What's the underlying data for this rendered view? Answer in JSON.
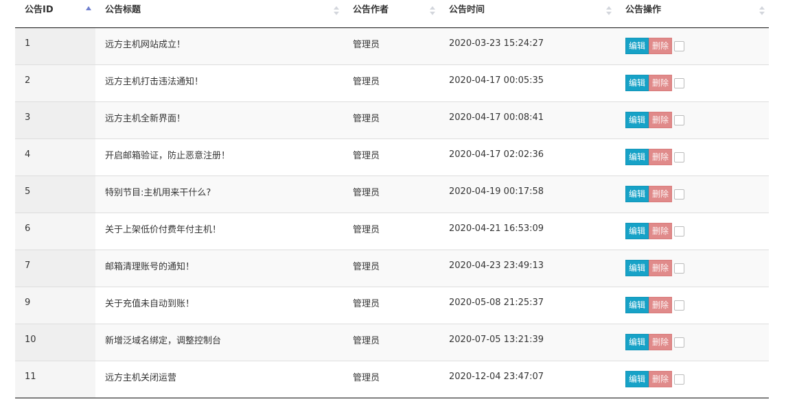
{
  "table": {
    "headers": {
      "id": "公告ID",
      "title": "公告标题",
      "author": "公告作者",
      "time": "公告时间",
      "ops": "公告操作"
    },
    "sort": {
      "column": "id",
      "direction": "ascending"
    },
    "edit_label": "编辑",
    "delete_label": "删除",
    "rows": [
      {
        "id": "1",
        "title": "远方主机网站成立！",
        "author": "管理员",
        "time": "2020-03-23 15:24:27"
      },
      {
        "id": "2",
        "title": "远方主机打击违法通知！",
        "author": "管理员",
        "time": "2020-04-17 00:05:35"
      },
      {
        "id": "3",
        "title": "远方主机全新界面！",
        "author": "管理员",
        "time": "2020-04-17 00:08:41"
      },
      {
        "id": "4",
        "title": "开启邮箱验证，防止恶意注册！",
        "author": "管理员",
        "time": "2020-04-17 02:02:36"
      },
      {
        "id": "5",
        "title": "特别节目:主机用来干什么?",
        "author": "管理员",
        "time": "2020-04-19 00:17:58"
      },
      {
        "id": "6",
        "title": "关于上架低价付费年付主机！",
        "author": "管理员",
        "time": "2020-04-21 16:53:09"
      },
      {
        "id": "7",
        "title": "邮箱清理账号的通知！",
        "author": "管理员",
        "time": "2020-04-23 23:49:13"
      },
      {
        "id": "9",
        "title": "关于充值未自动到账！",
        "author": "管理员",
        "time": "2020-05-08 21:25:37"
      },
      {
        "id": "10",
        "title": "新增泛域名绑定，调整控制台",
        "author": "管理员",
        "time": "2020-07-05 13:21:39"
      },
      {
        "id": "11",
        "title": "远方主机关闭运营",
        "author": "管理员",
        "time": "2020-12-04 23:47:07"
      }
    ]
  },
  "colors": {
    "edit_button": "#17a2c7",
    "delete_button": "#e08a8a",
    "sort_active": "#6f7fcf",
    "sort_inactive": "#d3d6dc"
  }
}
